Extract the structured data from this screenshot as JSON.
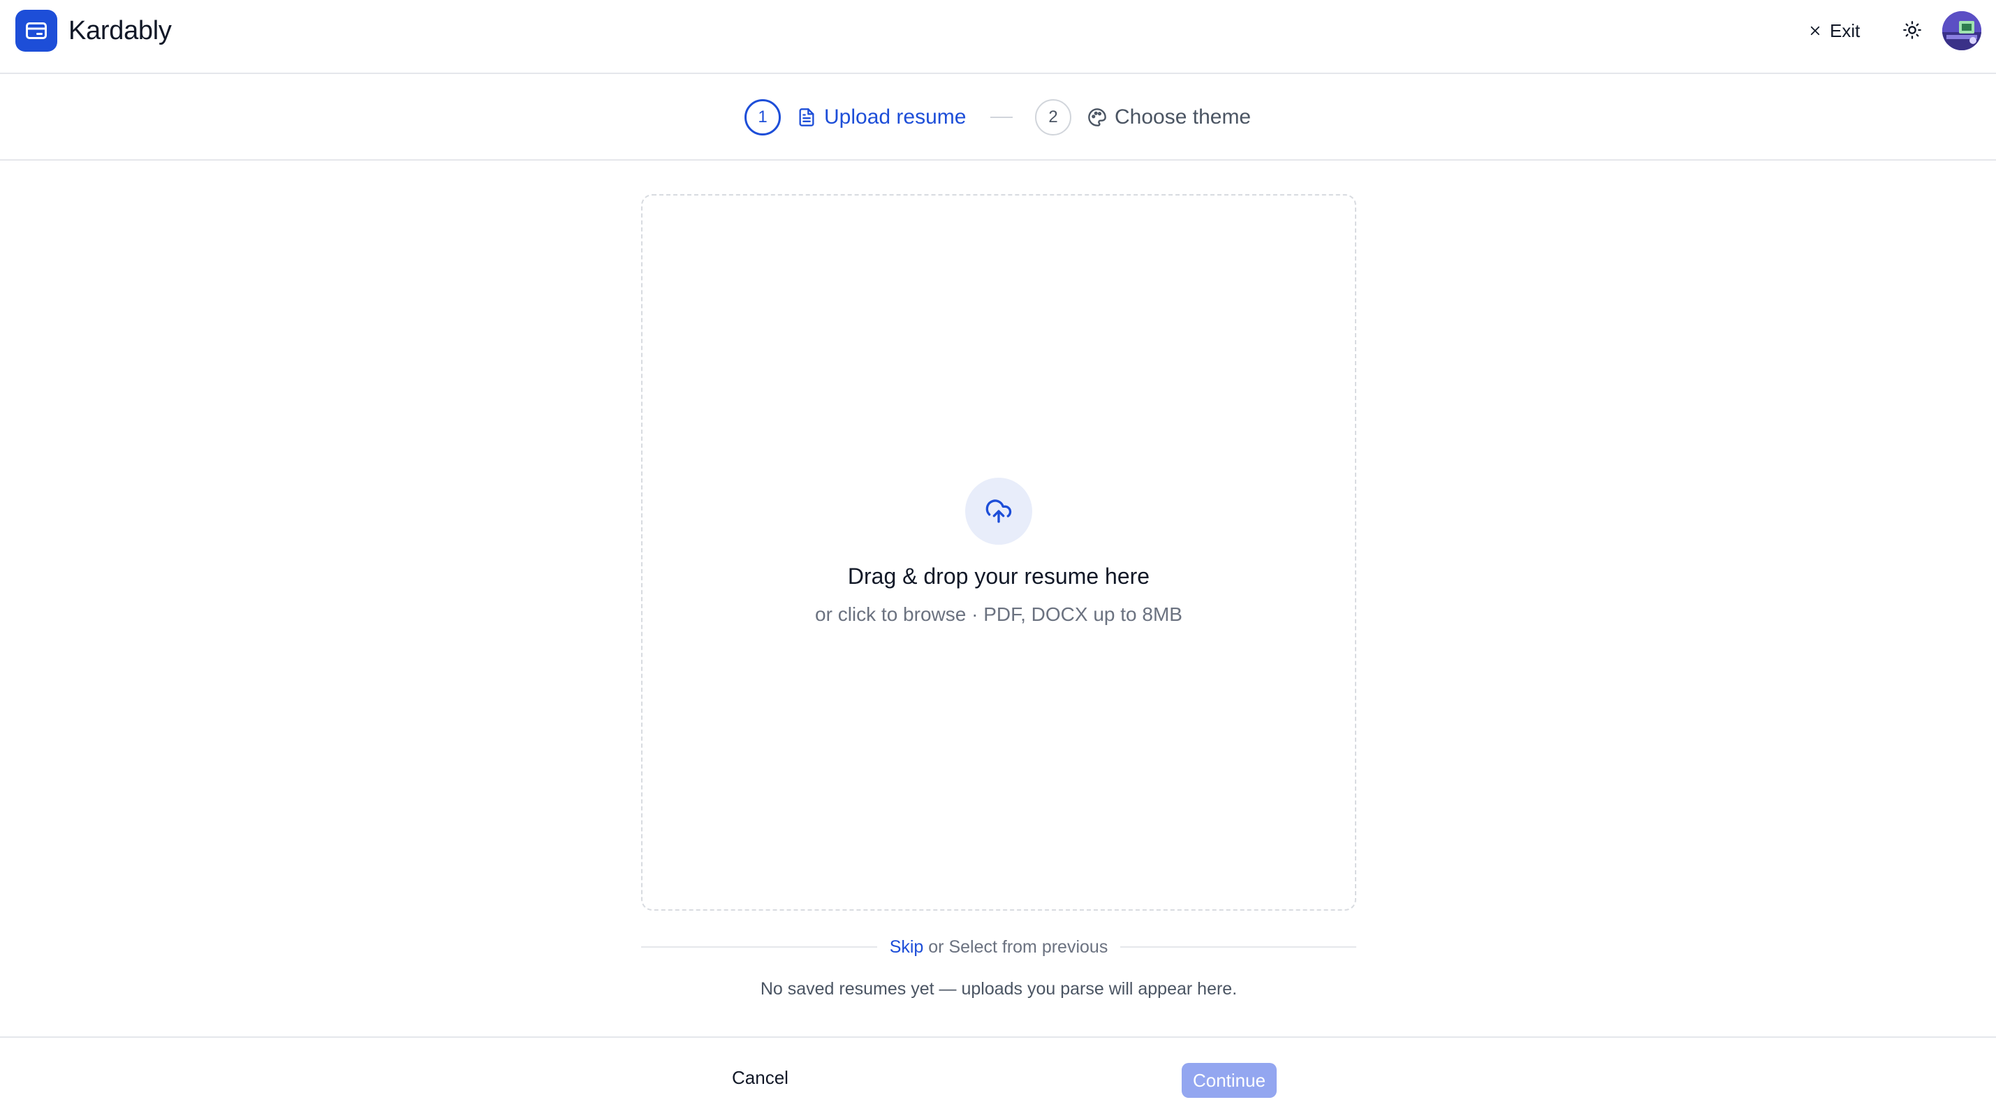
{
  "app": {
    "name": "Kardably",
    "logo_icon": "card-icon",
    "brand_color": "#1d4ed8"
  },
  "header": {
    "exit_label": "Exit",
    "exit_icon": "close-icon",
    "theme_icon": "sun-icon",
    "avatar_icon": "avatar"
  },
  "stepper": {
    "steps": [
      {
        "number": "1",
        "label": "Upload resume",
        "icon": "file-text-icon",
        "state": "active"
      },
      {
        "number": "2",
        "label": "Choose theme",
        "icon": "palette-icon",
        "state": "inactive"
      }
    ]
  },
  "dropzone": {
    "icon": "cloud-upload-icon",
    "title": "Drag & drop your resume here",
    "subtitle": "or click to browse · PDF, DOCX up to 8MB"
  },
  "previous": {
    "skip_label": "Skip",
    "select_text": "or Select from previous",
    "empty_message": "No saved resumes yet — uploads you parse will appear here."
  },
  "footer": {
    "cancel_label": "Cancel",
    "continue_label": "Continue",
    "continue_disabled": true
  },
  "colors": {
    "accent": "#1d4ed8",
    "continue_disabled_bg": "#93a6f0",
    "upload_circle_bg": "#e8edfa",
    "border": "#e5e7eb"
  }
}
